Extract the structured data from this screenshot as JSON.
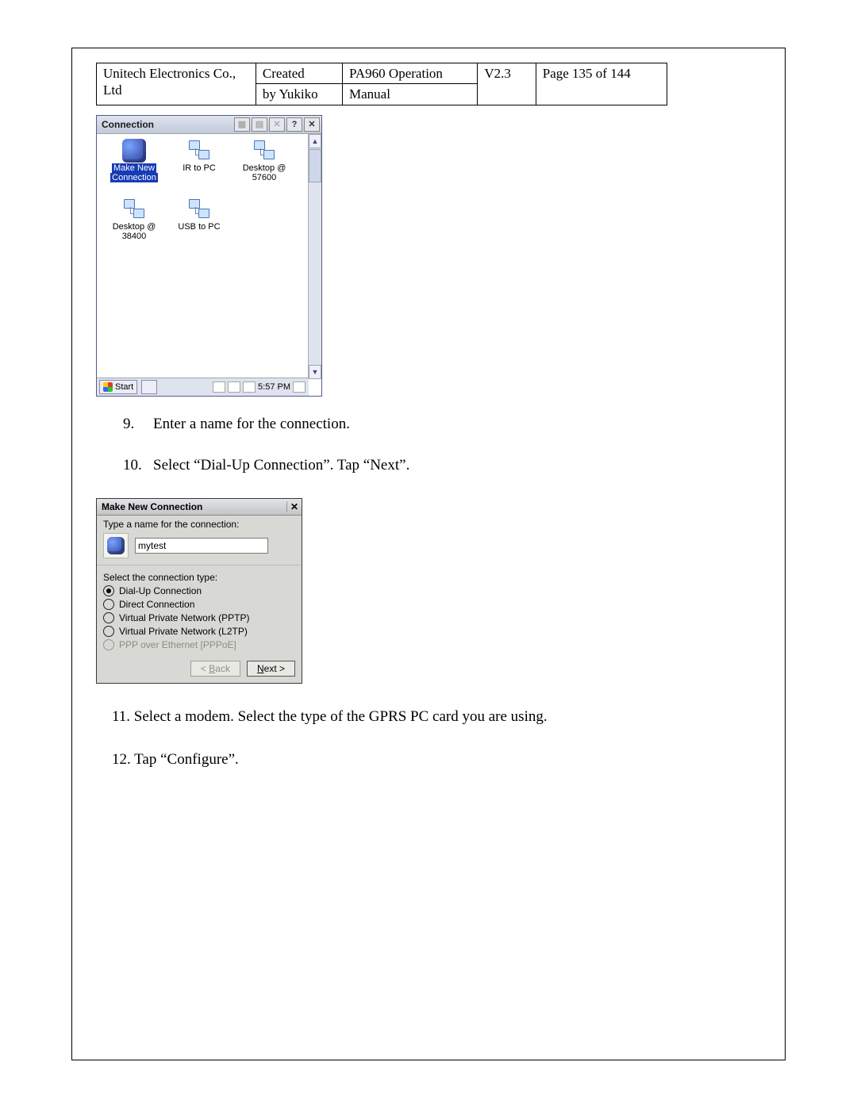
{
  "header": {
    "company": "Unitech Electronics Co., Ltd",
    "created_label": "Created",
    "created_by": "by Yukiko",
    "doc_title": "PA960 Operation",
    "doc_subtitle": "Manual",
    "version": "V2.3",
    "page": "Page 135 of 144"
  },
  "connection_window": {
    "title": "Connection",
    "toolbar": {
      "help": "?",
      "close": "✕"
    },
    "icons": [
      {
        "key": "make-new",
        "label_line1": "Make New",
        "label_line2": "Connection",
        "selected": true,
        "glyph": "globe"
      },
      {
        "key": "ir-to-pc",
        "label_line1": "IR to PC",
        "label_line2": "",
        "glyph": "net"
      },
      {
        "key": "desktop-57600",
        "label_line1": "Desktop @",
        "label_line2": "57600",
        "glyph": "net"
      },
      {
        "key": "desktop-38400",
        "label_line1": "Desktop @",
        "label_line2": "38400",
        "glyph": "net"
      },
      {
        "key": "usb-to-pc",
        "label_line1": "USB to PC",
        "label_line2": "",
        "glyph": "net"
      }
    ],
    "taskbar": {
      "start": "Start",
      "time": "5:57 PM"
    }
  },
  "steps": [
    {
      "n": "9.",
      "text": "Enter a name for the connection."
    },
    {
      "n": "10.",
      "text": "Select “Dial-Up Connection”. Tap “Next”."
    }
  ],
  "wizard": {
    "title": "Make New Connection",
    "close": "✕",
    "name_label": "Type a name for the connection:",
    "name_value": "mytest",
    "type_label": "Select the connection type:",
    "options": [
      {
        "label": "Dial-Up Connection",
        "checked": true,
        "disabled": false
      },
      {
        "label": "Direct Connection",
        "checked": false,
        "disabled": false
      },
      {
        "label": "Virtual Private Network (PPTP)",
        "checked": false,
        "disabled": false
      },
      {
        "label": "Virtual Private Network (L2TP)",
        "checked": false,
        "disabled": false
      },
      {
        "label": "PPP over Ethernet [PPPoE]",
        "checked": false,
        "disabled": true
      }
    ],
    "back_btn": {
      "prefix": "< ",
      "ul": "B",
      "rest": "ack"
    },
    "next_btn": {
      "ul": "N",
      "rest": "ext >"
    }
  },
  "after_steps": {
    "s11": "11. Select a modem. Select the type of the GPRS PC card you are using.",
    "s12": "12. Tap “Configure”."
  }
}
